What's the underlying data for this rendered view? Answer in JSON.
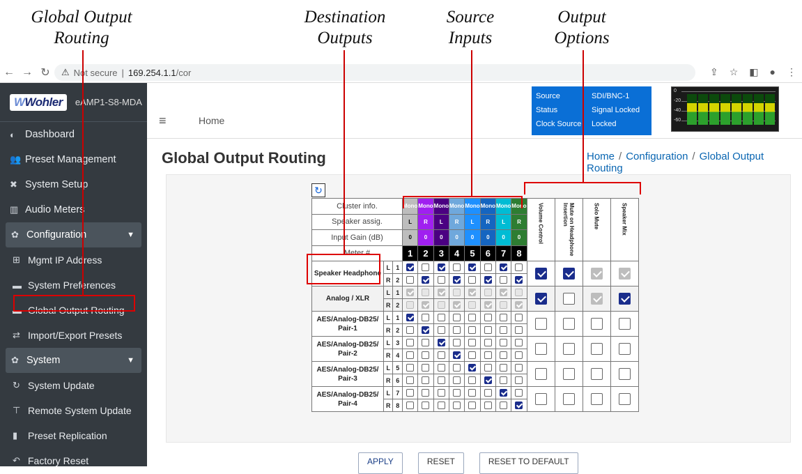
{
  "annotations": {
    "global_output_routing": [
      "Global Output",
      "Routing"
    ],
    "destination_outputs": [
      "Destination",
      "Outputs"
    ],
    "source_inputs": [
      "Source",
      "Inputs"
    ],
    "output_options": [
      "Output",
      "Options"
    ]
  },
  "browser": {
    "security": "Not secure",
    "separator": "|",
    "host": "169.254.1.1",
    "path": "/cor"
  },
  "sidebar": {
    "brand": "Wohler",
    "device": "eAMP1-S8-MDA",
    "items": [
      {
        "label": "Dashboard",
        "icon": "dashboard-icon"
      },
      {
        "label": "Preset Management",
        "icon": "users-icon"
      },
      {
        "label": "System Setup",
        "icon": "tools-icon"
      },
      {
        "label": "Audio Meters",
        "icon": "bar-chart-icon"
      },
      {
        "label": "Configuration",
        "icon": "gear-icon",
        "section": true
      },
      {
        "label": "Mgmt IP Address",
        "icon": "network-icon",
        "sub": true
      },
      {
        "label": "System Preferences",
        "icon": "card-icon",
        "sub": true
      },
      {
        "label": "Global Output Routing",
        "icon": "card-icon",
        "sub": true,
        "highlight": true
      },
      {
        "label": "Import/Export Presets",
        "icon": "arrows-icon",
        "sub": true
      },
      {
        "label": "System",
        "icon": "gears-icon",
        "section": true
      },
      {
        "label": "System Update",
        "icon": "sync-icon",
        "sub": true
      },
      {
        "label": "Remote System Update",
        "icon": "tree-icon",
        "sub": true
      },
      {
        "label": "Preset Replication",
        "icon": "copy-icon",
        "sub": true
      },
      {
        "label": "Factory Reset",
        "icon": "undo-icon",
        "sub": true
      }
    ]
  },
  "topbar": {
    "home": "Home",
    "status": {
      "source_label": "Source",
      "source_value": "SDI/BNC-1",
      "status_label": "Status",
      "status_value": "Signal Locked",
      "clock_label": "Clock Source",
      "clock_value": "Locked"
    },
    "meter": {
      "scale": [
        "0",
        "-20",
        "-40",
        "-60"
      ],
      "levels": [
        0.7,
        0.7,
        0.7,
        0.7,
        0.7,
        0.7,
        0.7,
        0.7
      ]
    }
  },
  "page": {
    "title": "Global Output Routing",
    "breadcrumb": [
      "Home",
      "Configuration",
      "Global Output Routing"
    ],
    "sep": "/"
  },
  "grid": {
    "row_labels": {
      "cluster": "Cluster info.",
      "speaker": "Speaker assig.",
      "gain": "Input Gain (dB)",
      "meter": "Meter #"
    },
    "cluster": [
      "Mono",
      "Mono",
      "Mono",
      "Mono",
      "Mono",
      "Mono",
      "Mono",
      "Mono"
    ],
    "cluster_colors": [
      "#bdbdbd",
      "#a020f0",
      "#4b0082",
      "#6fa8dc",
      "#1e90ff",
      "#1565c0",
      "#00bcd4",
      "#2e7d32"
    ],
    "speaker": [
      "L",
      "R",
      "L",
      "R",
      "L",
      "R",
      "L",
      "R"
    ],
    "gain": [
      "0",
      "0",
      "0",
      "0",
      "0",
      "0",
      "0",
      "0"
    ],
    "meter": [
      "1",
      "2",
      "3",
      "4",
      "5",
      "6",
      "7",
      "8"
    ],
    "options": [
      "Volume Control",
      "Mute on Headphone Insertion",
      "Solo Mute",
      "Speaker Mix"
    ],
    "destinations": [
      {
        "name": "Speaker Headphone",
        "disabled": false,
        "rows": [
          {
            "lr": "L",
            "ch": "1",
            "checks": [
              1,
              0,
              1,
              0,
              1,
              0,
              1,
              0
            ]
          },
          {
            "lr": "R",
            "ch": "2",
            "checks": [
              0,
              1,
              0,
              1,
              0,
              1,
              0,
              1
            ]
          }
        ],
        "options": [
          {
            "on": 1,
            "dis": 0
          },
          {
            "on": 1,
            "dis": 0
          },
          {
            "on": 1,
            "dis": 1
          },
          {
            "on": 1,
            "dis": 1
          }
        ]
      },
      {
        "name": "Analog / XLR",
        "disabled": true,
        "rows": [
          {
            "lr": "L",
            "ch": "1",
            "checks": [
              1,
              0,
              1,
              0,
              1,
              0,
              1,
              0
            ]
          },
          {
            "lr": "R",
            "ch": "2",
            "checks": [
              0,
              1,
              0,
              1,
              0,
              1,
              0,
              1
            ]
          }
        ],
        "options": [
          {
            "on": 1,
            "dis": 0
          },
          {
            "on": 0,
            "dis": 0
          },
          {
            "on": 1,
            "dis": 1
          },
          {
            "on": 1,
            "dis": 0
          }
        ]
      },
      {
        "name": "AES/Analog-DB25/ Pair-1",
        "disabled": false,
        "rows": [
          {
            "lr": "L",
            "ch": "1",
            "checks": [
              1,
              0,
              0,
              0,
              0,
              0,
              0,
              0
            ]
          },
          {
            "lr": "R",
            "ch": "2",
            "checks": [
              0,
              1,
              0,
              0,
              0,
              0,
              0,
              0
            ]
          }
        ],
        "options": [
          {
            "on": 0,
            "dis": 0
          },
          {
            "on": 0,
            "dis": 0
          },
          {
            "on": 0,
            "dis": 0
          },
          {
            "on": 0,
            "dis": 0
          }
        ]
      },
      {
        "name": "AES/Analog-DB25/ Pair-2",
        "disabled": false,
        "rows": [
          {
            "lr": "L",
            "ch": "3",
            "checks": [
              0,
              0,
              1,
              0,
              0,
              0,
              0,
              0
            ]
          },
          {
            "lr": "R",
            "ch": "4",
            "checks": [
              0,
              0,
              0,
              1,
              0,
              0,
              0,
              0
            ]
          }
        ],
        "options": [
          {
            "on": 0,
            "dis": 0
          },
          {
            "on": 0,
            "dis": 0
          },
          {
            "on": 0,
            "dis": 0
          },
          {
            "on": 0,
            "dis": 0
          }
        ]
      },
      {
        "name": "AES/Analog-DB25/ Pair-3",
        "disabled": false,
        "rows": [
          {
            "lr": "L",
            "ch": "5",
            "checks": [
              0,
              0,
              0,
              0,
              1,
              0,
              0,
              0
            ]
          },
          {
            "lr": "R",
            "ch": "6",
            "checks": [
              0,
              0,
              0,
              0,
              0,
              1,
              0,
              0
            ]
          }
        ],
        "options": [
          {
            "on": 0,
            "dis": 0
          },
          {
            "on": 0,
            "dis": 0
          },
          {
            "on": 0,
            "dis": 0
          },
          {
            "on": 0,
            "dis": 0
          }
        ]
      },
      {
        "name": "AES/Analog-DB25/ Pair-4",
        "disabled": false,
        "rows": [
          {
            "lr": "L",
            "ch": "7",
            "checks": [
              0,
              0,
              0,
              0,
              0,
              0,
              1,
              0
            ]
          },
          {
            "lr": "R",
            "ch": "8",
            "checks": [
              0,
              0,
              0,
              0,
              0,
              0,
              0,
              1
            ]
          }
        ],
        "options": [
          {
            "on": 0,
            "dis": 0
          },
          {
            "on": 0,
            "dis": 0
          },
          {
            "on": 0,
            "dis": 0
          },
          {
            "on": 0,
            "dis": 0
          }
        ]
      }
    ]
  },
  "buttons": {
    "apply": "APPLY",
    "reset": "RESET",
    "reset_default": "RESET TO DEFAULT"
  }
}
